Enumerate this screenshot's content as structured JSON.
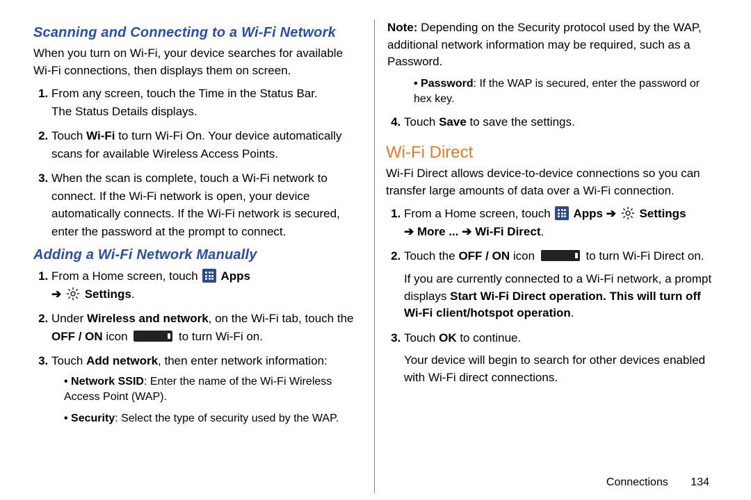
{
  "left": {
    "h1": "Scanning and Connecting to a Wi-Fi Network",
    "intro": "When you turn on Wi-Fi, your device searches for available Wi-Fi connections, then displays them on screen.",
    "steps1": {
      "s1a": "From any screen, touch the Time in the Status Bar.",
      "s1b": "The Status Details displays.",
      "s2a": "Touch ",
      "s2wifi": "Wi-Fi",
      "s2b": " to turn Wi-Fi On. Your device automatically scans for available Wireless Access Points.",
      "s3": "When the scan is complete, touch a Wi-Fi network to connect. If the Wi-Fi network is open, your device automatically connects. If the Wi-Fi network is secured, enter the password at the prompt to connect."
    },
    "h2": "Adding a Wi-Fi Network Manually",
    "steps2": {
      "s1a": "From a Home screen, touch ",
      "s1apps": " Apps",
      "s1arrow": "➔",
      "s1settings": "Settings",
      "s1end": ".",
      "s2a": "Under ",
      "s2wn": "Wireless and network",
      "s2b": ", on the Wi-Fi tab, touch the ",
      "s2off": "OFF / ON",
      "s2c": " icon ",
      "s2d": " to turn Wi-Fi on.",
      "s3a": "Touch ",
      "s3add": "Add network",
      "s3b": ", then enter network information:",
      "b1label": "Network SSID",
      "b1text": ": Enter the name of the Wi-Fi Wireless Access Point (WAP).",
      "b2label": "Security",
      "b2text": ": Select the type of security used by the WAP."
    }
  },
  "right": {
    "note_label": "Note:",
    "note_text": " Depending on the Security protocol used by the WAP, additional network information may be required, such as a Password.",
    "b3label": "Password",
    "b3text": ": If the WAP is secured, enter the password or hex key.",
    "s4a": "Touch ",
    "s4save": "Save",
    "s4b": " to save the settings.",
    "h3": "Wi-Fi Direct",
    "intro2": "Wi-Fi Direct allows device-to-device connections so you can transfer large amounts of data over a Wi-Fi connection.",
    "wfd": {
      "s1a": "From a Home screen, touch ",
      "s1apps": " Apps ",
      "arrow": "➔",
      "s1settings": " Settings ",
      "s1more": " More ... ",
      "s1wfd": " Wi-Fi Direct",
      "s1end": ".",
      "s2a": "Touch the ",
      "s2off": "OFF / ON",
      "s2b": " icon ",
      "s2c": " to turn Wi-Fi Direct on.",
      "s2d": "If you are currently connected to a Wi-Fi network, a prompt displays ",
      "s2prompt": "Start Wi-Fi Direct operation. This will turn off Wi-Fi client/hotspot operation",
      "s2e": ".",
      "s3a": "Touch ",
      "s3ok": "OK",
      "s3b": " to continue.",
      "s3c": "Your device will begin to search for other devices enabled with Wi-Fi direct connections."
    }
  },
  "footer": {
    "label": "Connections",
    "page": "134"
  }
}
